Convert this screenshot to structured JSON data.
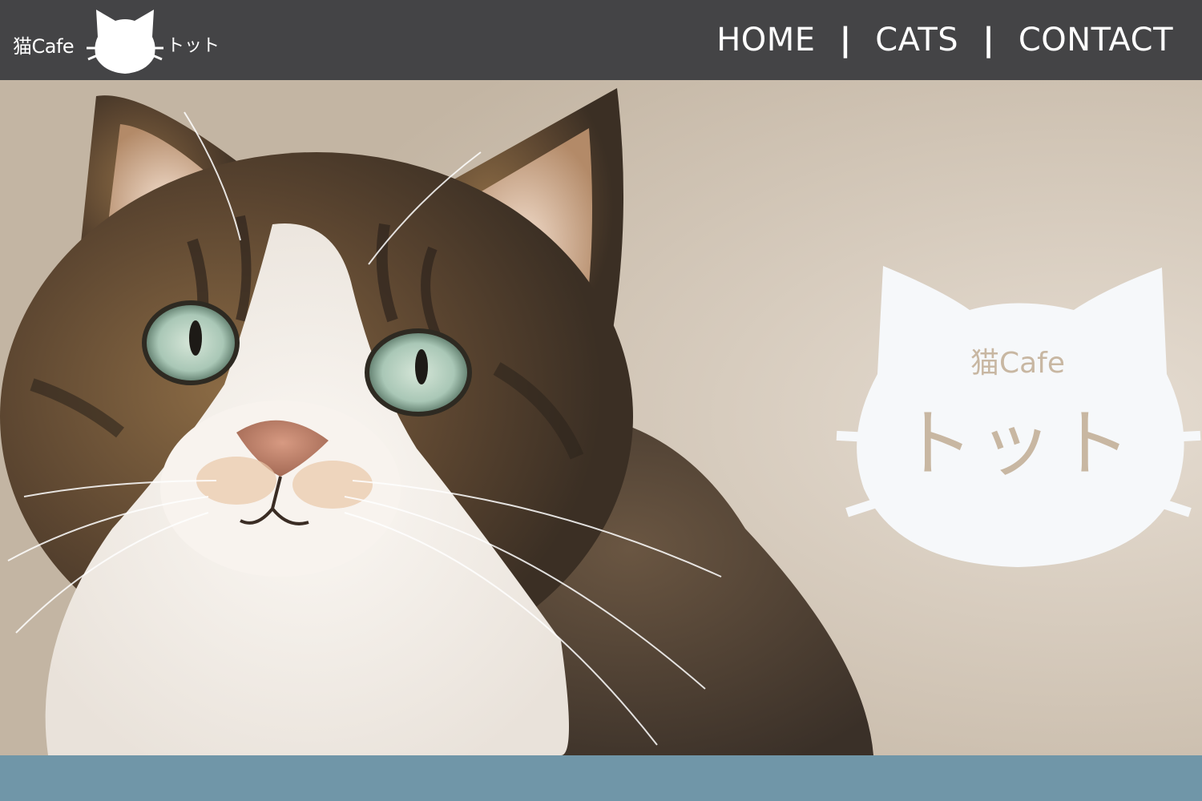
{
  "header": {
    "brand": {
      "prefix": "猫Cafe",
      "name": "トット",
      "logo_icon": "cat-head-icon"
    },
    "nav": [
      {
        "label": "HOME"
      },
      {
        "label": "CATS"
      },
      {
        "label": "CONTACT"
      }
    ],
    "separator": "|"
  },
  "hero": {
    "image": "tabby-cat-photo",
    "logo": {
      "prefix": "猫Cafe",
      "name": "トット",
      "icon": "cat-head-icon"
    }
  },
  "colors": {
    "header_bg": "#444446",
    "nav_text": "#ffffff",
    "logo_fill": "#f6f8fa",
    "logo_text": "#c8b7a2",
    "bottom_band": "#7096a8"
  }
}
